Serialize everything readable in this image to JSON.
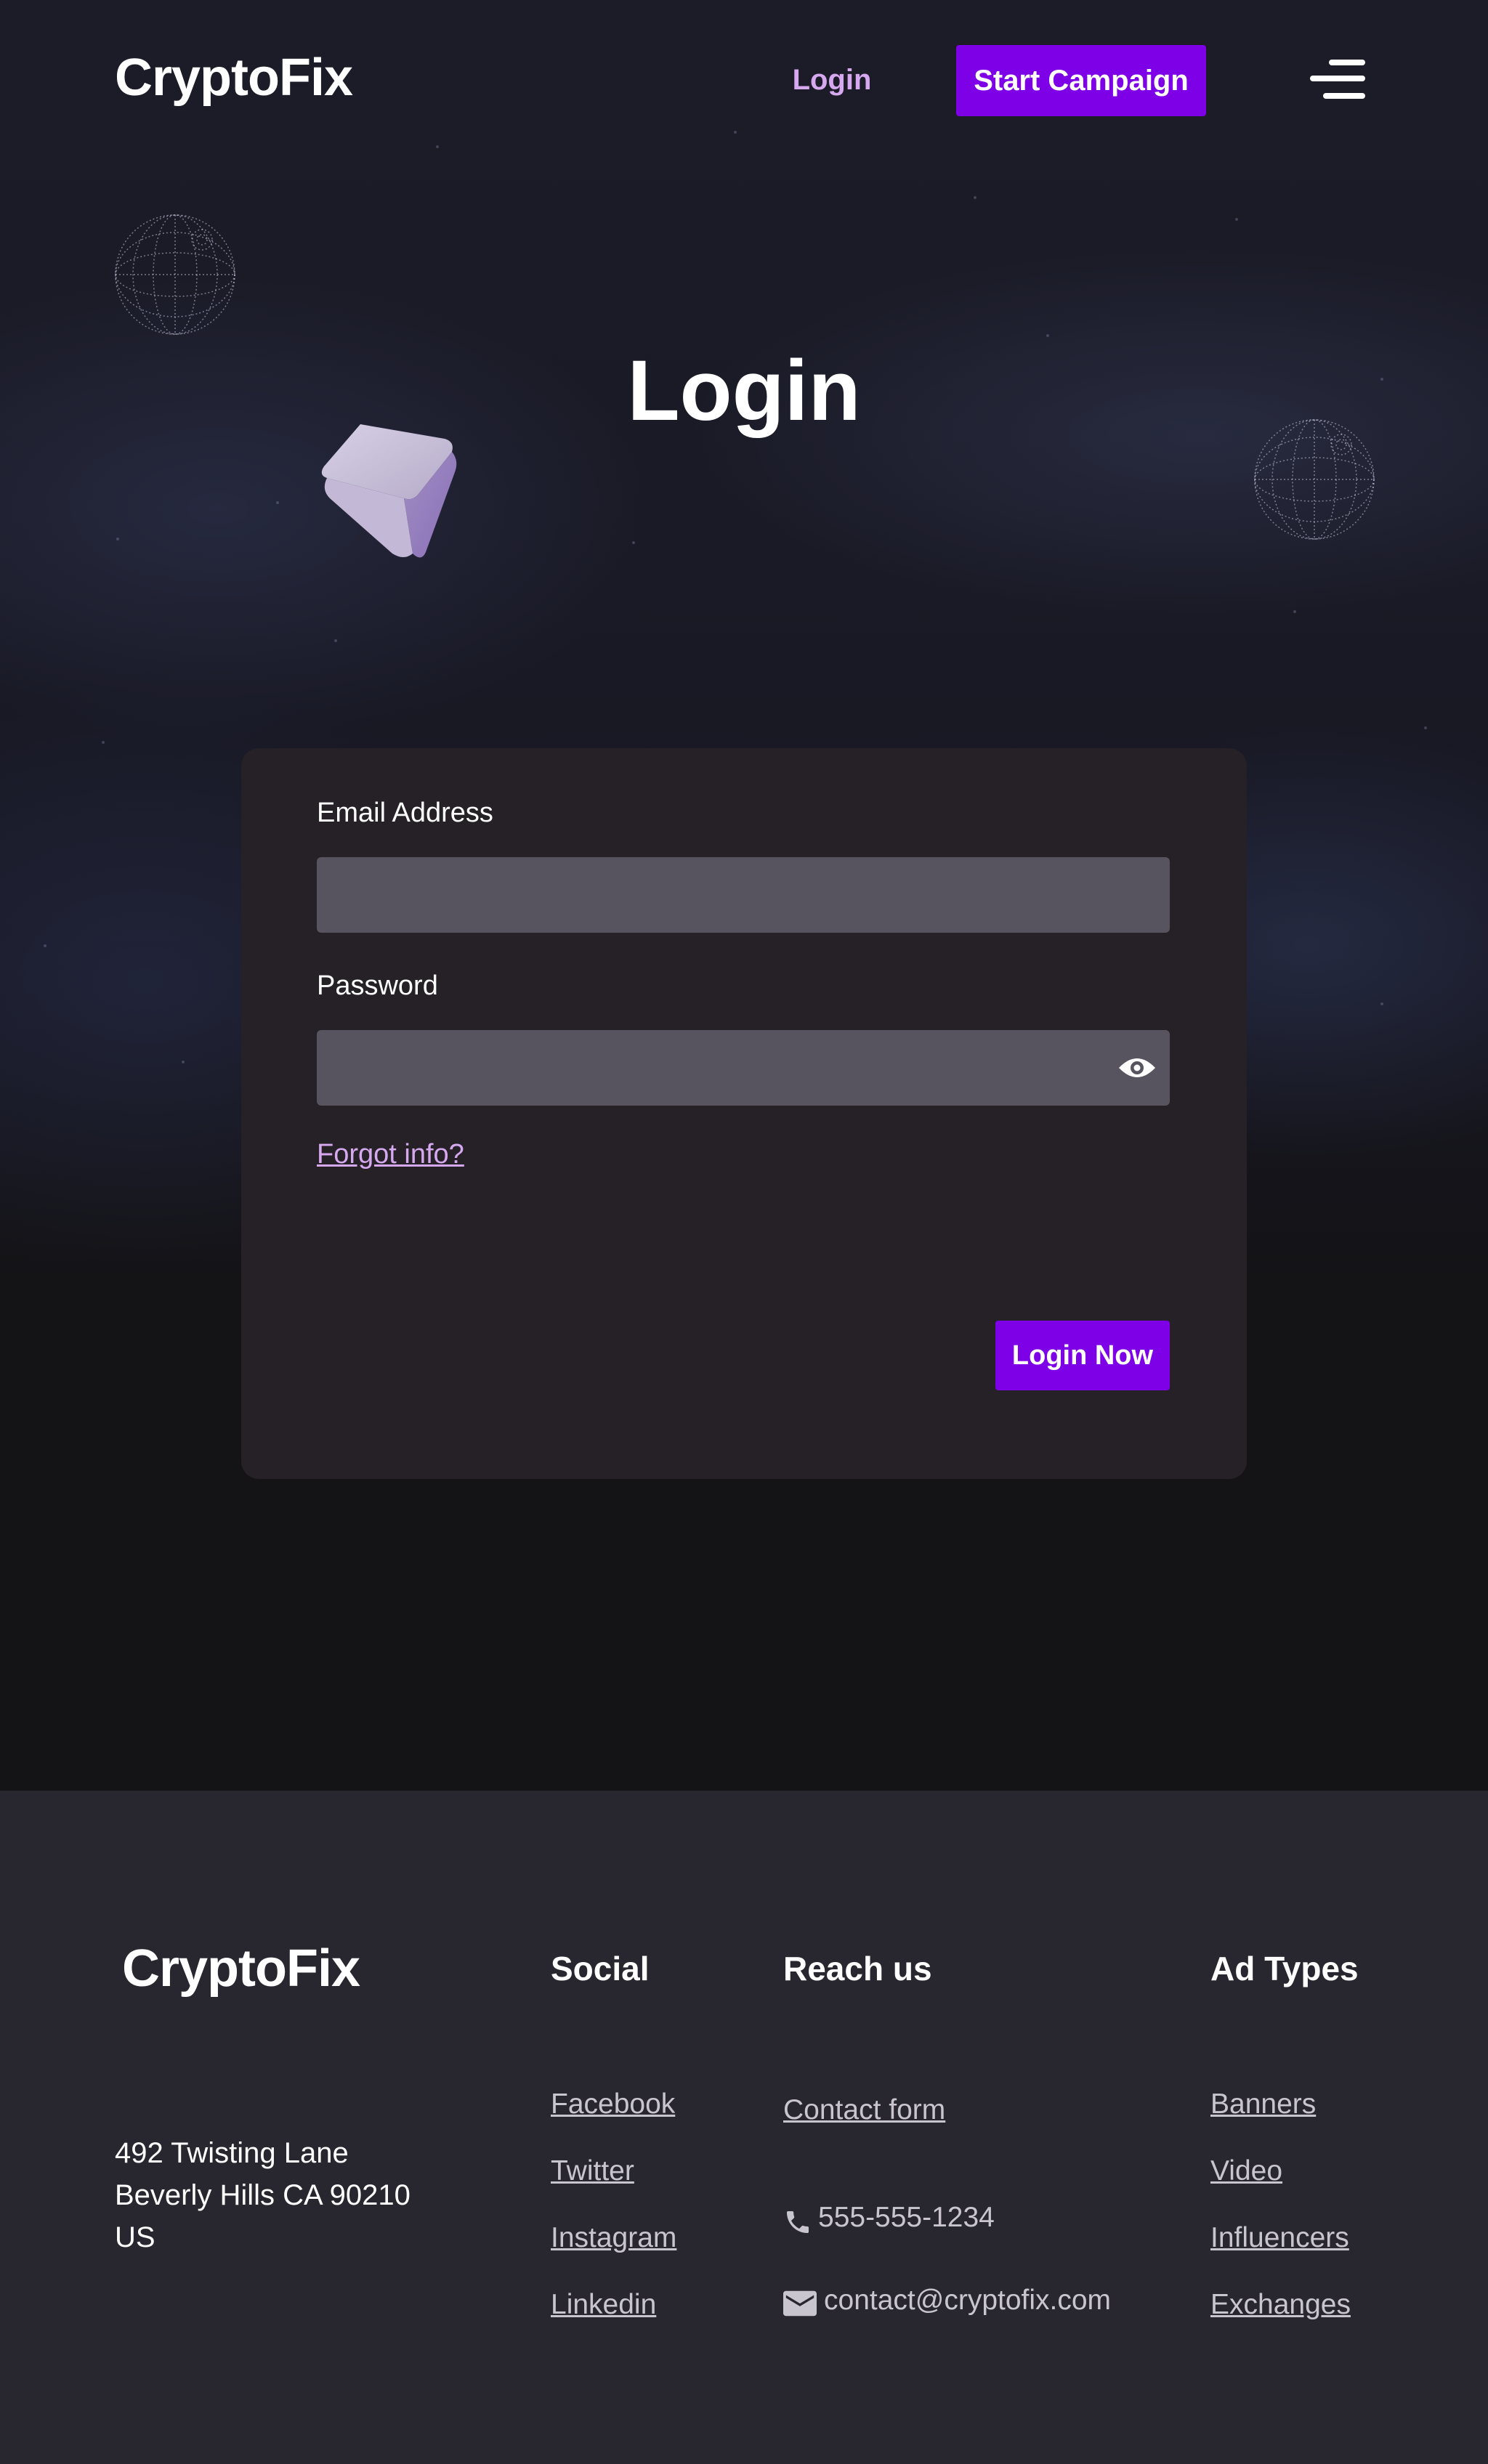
{
  "header": {
    "logo": "CryptoFix",
    "nav_login": "Login",
    "start_campaign": "Start Campaign",
    "menu_icon": "hamburger-menu-icon"
  },
  "main": {
    "title": "Login",
    "form": {
      "email_label": "Email Address",
      "email_value": "",
      "password_label": "Password",
      "password_value": "",
      "show_password_icon": "eye-icon",
      "forgot_link": "Forgot info?",
      "submit_label": "Login Now"
    }
  },
  "footer": {
    "logo": "CryptoFix",
    "address": {
      "line1": "492 Twisting Lane",
      "line2": "Beverly Hills CA 90210",
      "line3": "US"
    },
    "social": {
      "heading": "Social",
      "links": [
        "Facebook",
        "Twitter",
        "Instagram",
        "Linkedin"
      ]
    },
    "reach": {
      "heading": "Reach us",
      "contact_form": "Contact form",
      "phone_icon": "phone-icon",
      "phone": "555-555-1234",
      "email_icon": "mail-icon",
      "email": "contact@cryptofix.com"
    },
    "ad_types": {
      "heading": "Ad Types",
      "links": [
        "Banners",
        "Video",
        "Influencers",
        "Exchanges"
      ]
    }
  },
  "colors": {
    "accent": "#7d00e6",
    "link": "#d6a8f0",
    "background": "#141316",
    "card": "#252127",
    "footer": "#28262e",
    "input": "#57535f"
  }
}
